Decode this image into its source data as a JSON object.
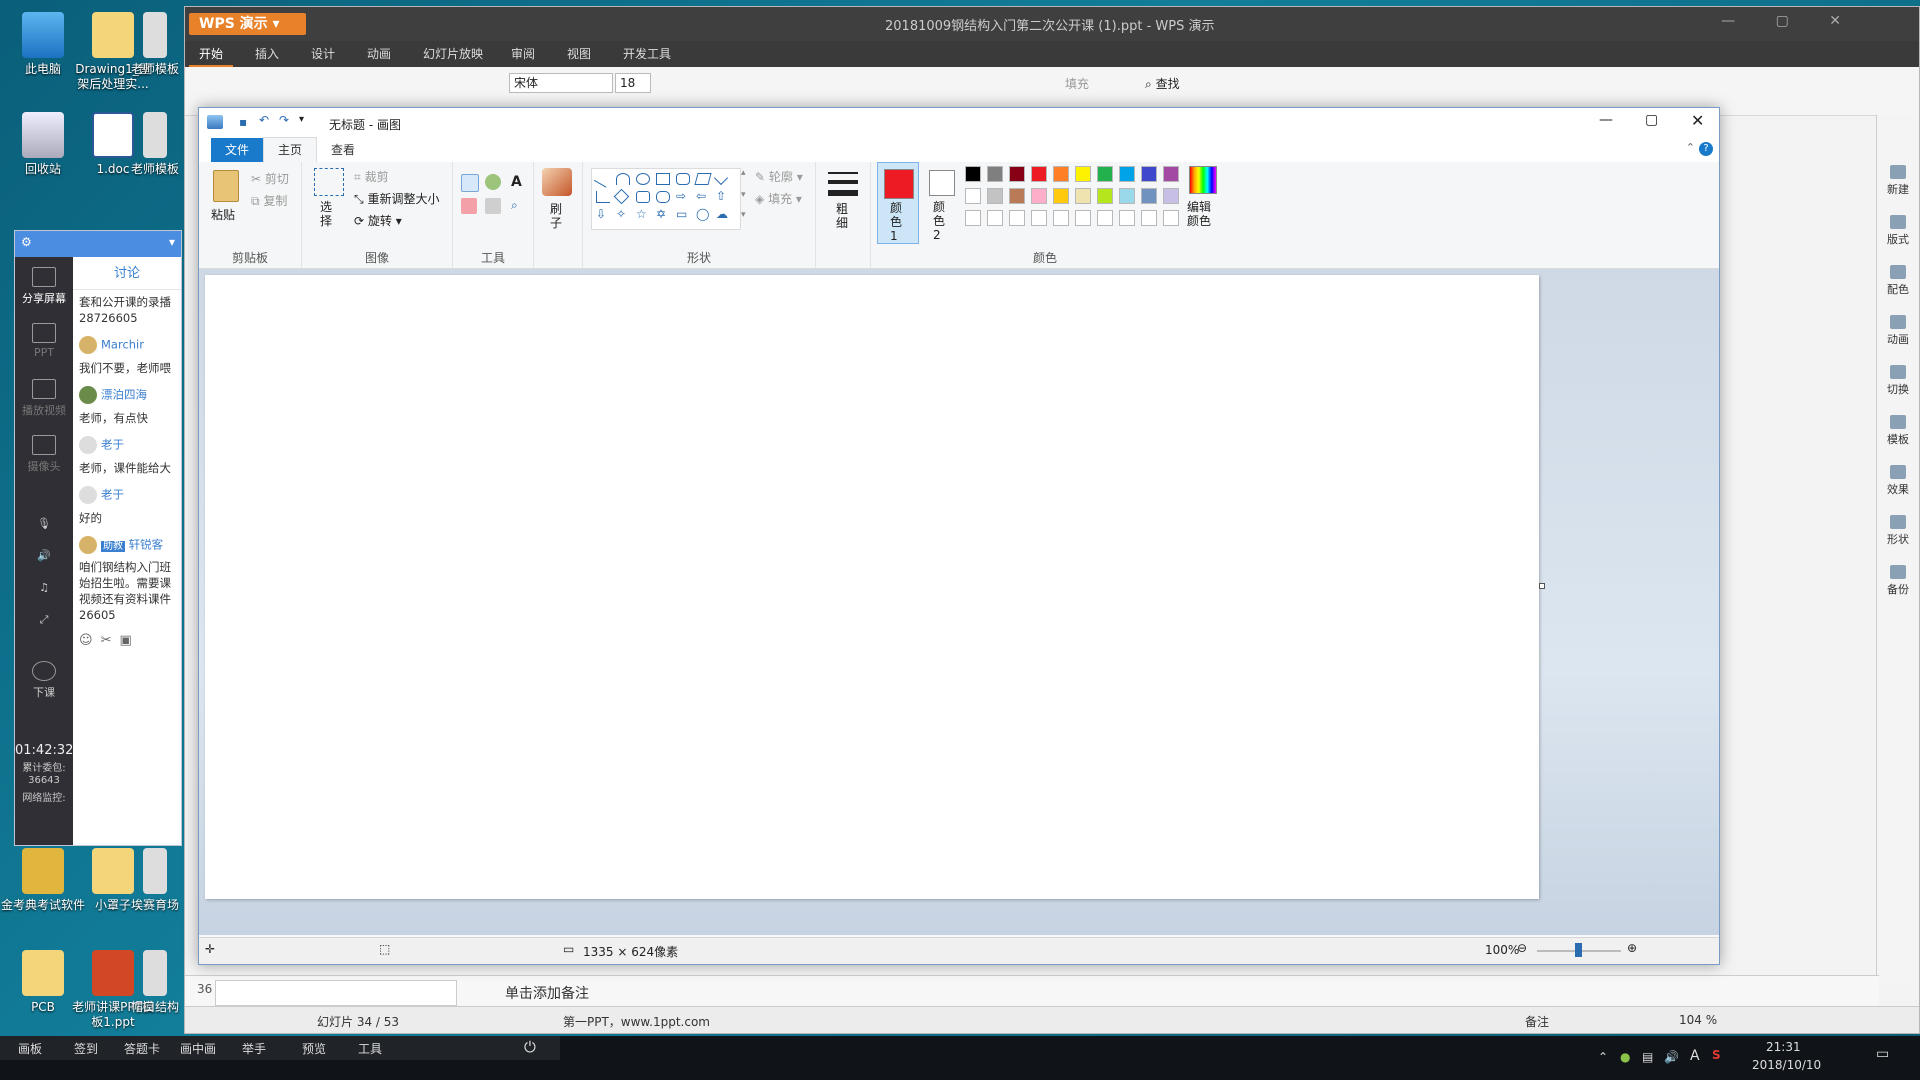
{
  "desktop": {
    "icons": [
      "此电脑",
      "Drawing1_屋架后处理实...",
      "老师模板",
      "回收站",
      "1.doc",
      "老师模板",
      "金考典考试软件",
      "小罩子",
      "埃赛育场",
      "PCB",
      "老师讲课PPT模板1.ppt",
      "帽口结构"
    ]
  },
  "wps": {
    "app_badge": "WPS 演示",
    "title": "20181009钢结构入门第二次公开课 (1).ppt - WPS 演示",
    "tabs": [
      "开始",
      "插入",
      "设计",
      "动画",
      "幻灯片放映",
      "审阅",
      "视图",
      "开发工具"
    ],
    "font_name": "宋体",
    "font_size": "18",
    "find_label": "查找",
    "fill_label": "填充",
    "side_items": [
      "新建",
      "版式",
      "配色",
      "动画",
      "切换",
      "模板",
      "效果",
      "形状",
      "备份"
    ],
    "slide_number": "36",
    "notes_placeholder": "单击添加备注",
    "status_slide": "幻灯片 34 / 53",
    "status_theme": "第一PPT，www.1ppt.com",
    "status_notes": "备注",
    "status_zoom": "104 %"
  },
  "chat": {
    "tab_label": "讨论",
    "left_items": [
      "分享屏幕",
      "PPT",
      "播放视频",
      "摄像头",
      "下课"
    ],
    "timer": "01:42:32",
    "stats": [
      "累计委包: 36643",
      "网络监控:"
    ],
    "messages": [
      {
        "name": "",
        "text": "套和公开课的录播 28726605"
      },
      {
        "name": "Marchir",
        "text": "我们不要，老师喂"
      },
      {
        "name": "漂泊四海",
        "text": "老师，有点快"
      },
      {
        "name": "老于",
        "text": "老师，课件能给大"
      },
      {
        "name": "老于",
        "text": "好的"
      },
      {
        "name": "轩锐客",
        "text": "咱们钢结构入门班始招生啦。需要课视频还有资料课件 26605"
      }
    ],
    "badge": "助教"
  },
  "paint": {
    "title": "无标题 - 画图",
    "tabs": [
      "文件",
      "主页",
      "查看"
    ],
    "groups": {
      "clipboard": {
        "label": "剪贴板",
        "paste": "粘贴",
        "cut": "剪切",
        "copy": "复制"
      },
      "image": {
        "label": "图像",
        "select": "选择",
        "crop": "裁剪",
        "resize": "重新调整大小",
        "rotate": "旋转"
      },
      "tools": {
        "label": "工具"
      },
      "brushes": {
        "label": "刷子"
      },
      "shapes": {
        "label": "形状",
        "outline": "轮廓",
        "fill": "填充"
      },
      "size": {
        "label": "粗细"
      },
      "colors": {
        "label": "颜色",
        "color1": "颜色 1",
        "color2": "颜色 2",
        "edit": "编辑颜色"
      }
    },
    "palette": [
      "#000000",
      "#7f7f7f",
      "#880015",
      "#ed1c24",
      "#ff7f27",
      "#fff200",
      "#22b14c",
      "#00a2e8",
      "#3f48cc",
      "#a349a4",
      "#ffffff",
      "#c3c3c3",
      "#b97a57",
      "#ffaec9",
      "#ffc90e",
      "#efe4b0",
      "#b5e61d",
      "#99d9ea",
      "#7092be",
      "#c8bfe7"
    ],
    "color1": "#ed1c24",
    "color2": "#ffffff",
    "status": {
      "size": "1335 × 624像素",
      "zoom": "100%"
    }
  },
  "taskbar": {
    "left_items": [
      "画板",
      "签到",
      "答题卡",
      "画中画",
      "举手",
      "预览",
      "工具"
    ],
    "time": "21:31",
    "date": "2018/10/10"
  }
}
